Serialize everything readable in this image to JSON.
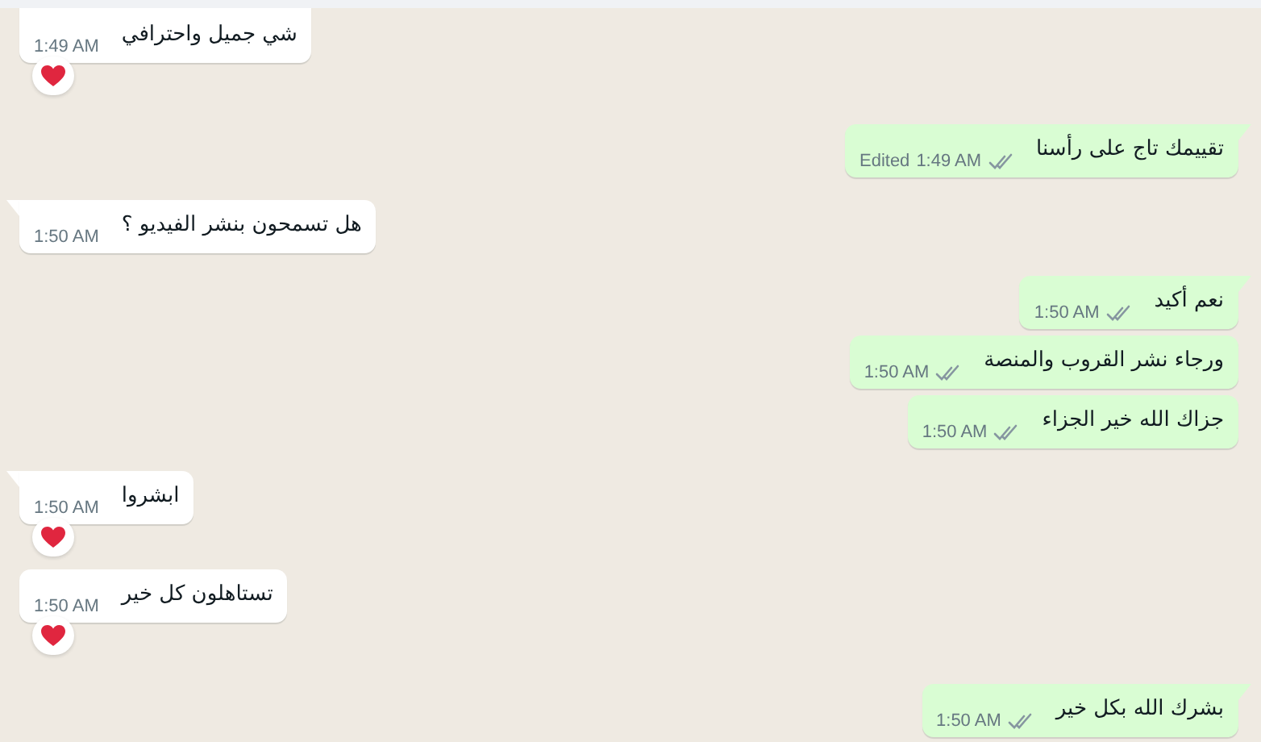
{
  "messages": [
    {
      "kind": "received",
      "text": "شي جميل واحترافي",
      "time": "1:49 AM",
      "tail": false,
      "reacted": true
    },
    {
      "kind": "sent",
      "text": "تقييمك تاج على رأسنا",
      "edited": "Edited",
      "time": "1:49 AM",
      "tail": true,
      "reacted": false
    },
    {
      "kind": "received",
      "text": "هل تسمحون بنشر الفيديو ؟",
      "time": "1:50 AM",
      "tail": true,
      "reacted": false
    },
    {
      "kind": "sent",
      "text": "نعم أكيد",
      "time": "1:50 AM",
      "tail": true,
      "reacted": false
    },
    {
      "kind": "sent",
      "text": "ورجاء نشر القروب والمنصة",
      "time": "1:50 AM",
      "tail": false,
      "reacted": false
    },
    {
      "kind": "sent",
      "text": "جزاك الله خير الجزاء",
      "time": "1:50 AM",
      "tail": false,
      "reacted": false
    },
    {
      "kind": "received",
      "text": "ابشروا",
      "time": "1:50 AM",
      "tail": true,
      "reacted": true
    },
    {
      "kind": "received",
      "text": "تستاهلون كل خير",
      "time": "1:50 AM",
      "tail": false,
      "reacted": true
    },
    {
      "kind": "sent",
      "text": "بشرك الله بكل خير",
      "time": "1:50 AM",
      "tail": true,
      "reacted": false
    }
  ]
}
